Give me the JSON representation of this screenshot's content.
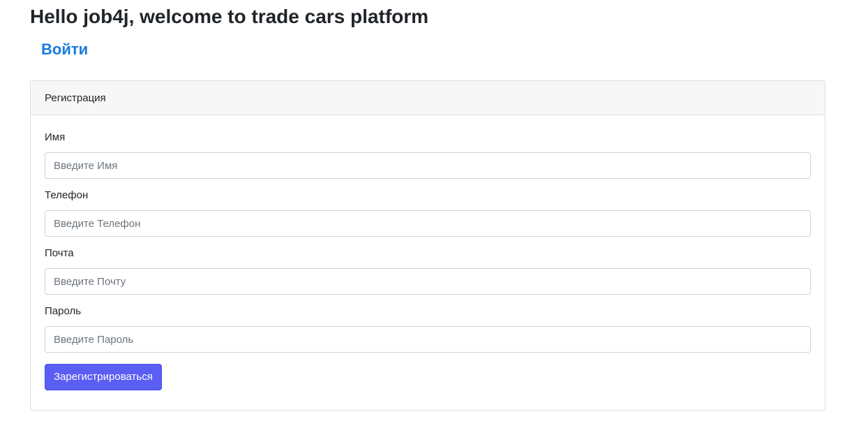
{
  "header": {
    "title": "Hello job4j, welcome to trade cars platform",
    "login_link": "Войти"
  },
  "card": {
    "title": "Регистрация",
    "fields": [
      {
        "label": "Имя",
        "placeholder": "Введите Имя",
        "value": ""
      },
      {
        "label": "Телефон",
        "placeholder": "Введите Телефон",
        "value": ""
      },
      {
        "label": "Почта",
        "placeholder": "Введите Почту",
        "value": ""
      },
      {
        "label": "Пароль",
        "placeholder": "Введите Пароль",
        "value": ""
      }
    ],
    "submit_label": "Зарегистрироваться"
  },
  "colors": {
    "link": "#1a7ce0",
    "button": "#5a5ef2",
    "header_bg": "#f7f7f7",
    "border": "#dfdfdf"
  }
}
